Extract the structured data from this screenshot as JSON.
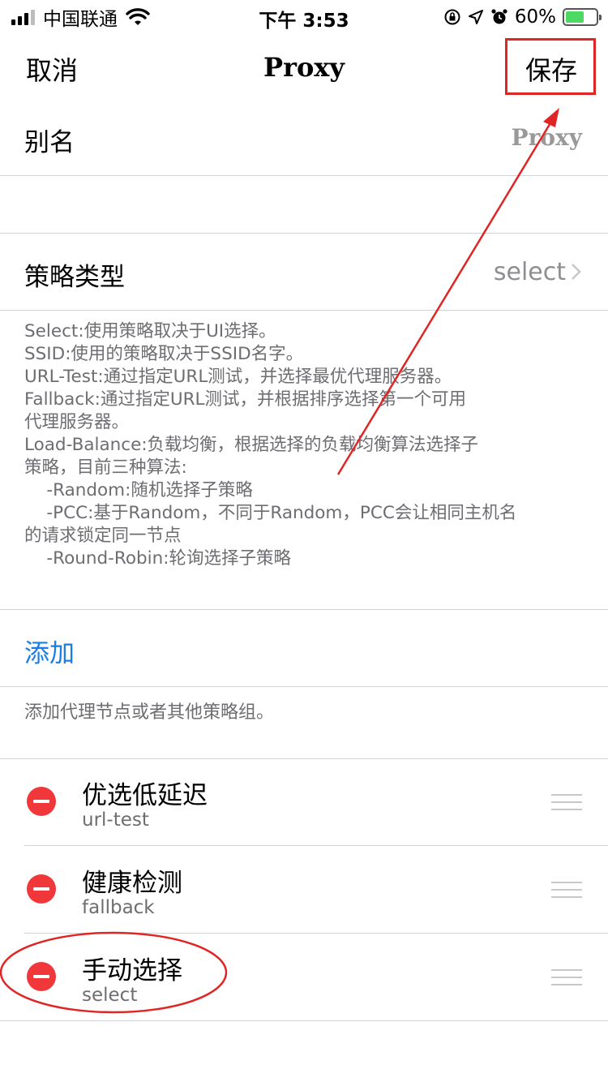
{
  "status_bar": {
    "carrier": "中国联通",
    "time": "下午 3:53",
    "battery": "60%",
    "battery_level": 0.6
  },
  "nav": {
    "cancel": "取消",
    "title": "Proxy",
    "save": "保存"
  },
  "alias": {
    "label": "别名",
    "value": "Proxy"
  },
  "policy_type": {
    "label": "策略类型",
    "value": "select"
  },
  "description": "Select:使用策略取决于UI选择。\nSSID:使用的策略取决于SSID名字。\nURL-Test:通过指定URL测试，并选择最优代理服务器。\nFallback:通过指定URL测试，并根据排序选择第一个可用\n代理服务器。\nLoad-Balance:负载均衡，根据选择的负载均衡算法选择子\n策略，目前三种算法:\n    -Random:随机选择子策略\n    -PCC:基于Random，不同于Random，PCC会让相同主机名\n的请求锁定同一节点\n    -Round-Robin:轮询选择子策略",
  "add": {
    "label": "添加",
    "hint": "添加代理节点或者其他策略组。"
  },
  "items": [
    {
      "title": "优选低延迟",
      "subtitle": "url-test"
    },
    {
      "title": "健康检测",
      "subtitle": "fallback"
    },
    {
      "title": "手动选择",
      "subtitle": "select"
    }
  ],
  "colors": {
    "accent": "#1a7ce6",
    "delete": "#f0383b",
    "annotation": "#e02525"
  },
  "icons": [
    "signal-icon",
    "wifi-icon",
    "lock-rotation-icon",
    "location-icon",
    "alarm-icon",
    "battery-icon",
    "chevron-right-icon",
    "minus-circle-icon",
    "drag-handle-icon"
  ]
}
